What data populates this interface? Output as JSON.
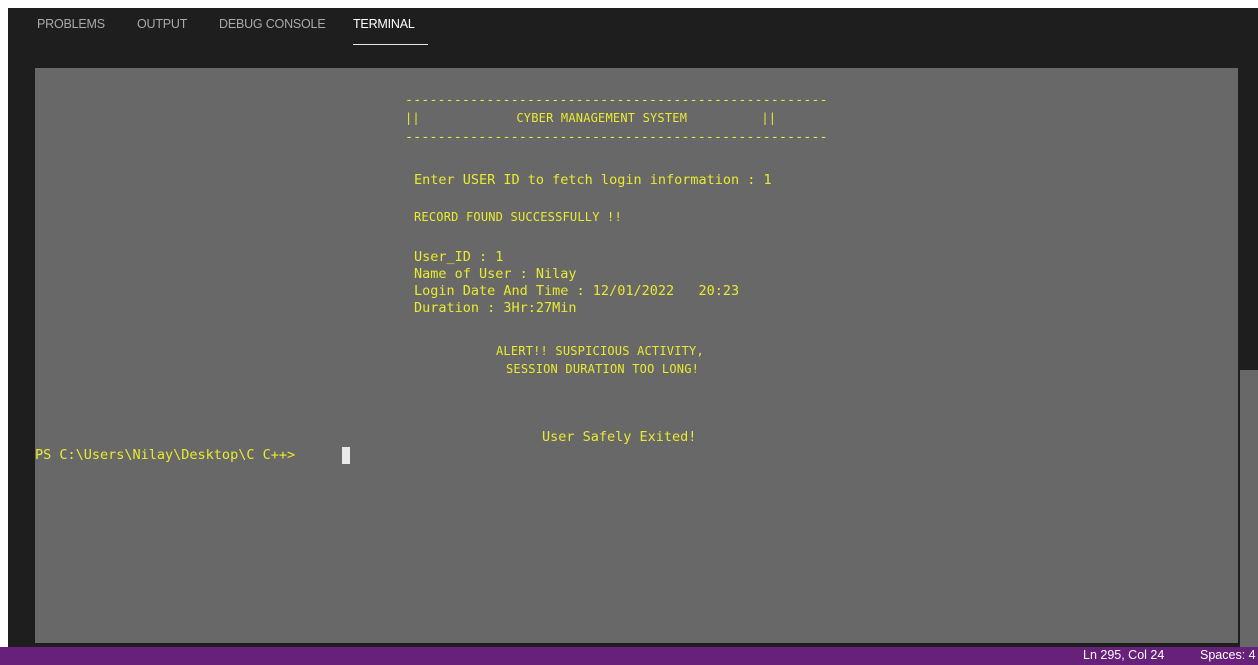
{
  "tabs": {
    "problems": "PROBLEMS",
    "output": "OUTPUT",
    "debug_console": "DEBUG CONSOLE",
    "terminal": "TERMINAL"
  },
  "terminal": {
    "border_top": "----------------------------------------------------",
    "title_line": "||             CYBER MANAGEMENT SYSTEM          ||",
    "border_bottom": "----------------------------------------------------",
    "prompt_line": "Enter USER ID to fetch login information : 1",
    "record_found": "RECORD FOUND SUCCESSFULLY !!",
    "user_id": "User_ID : 1",
    "user_name": "Name of User : Nilay",
    "login_datetime": "Login Date And Time : 12/01/2022   20:23",
    "duration": "Duration : 3Hr:27Min",
    "alert_line1": "ALERT!! SUSPICIOUS ACTIVITY,",
    "alert_line2": "SESSION DURATION TOO LONG!",
    "exit_message": "User Safely Exited!",
    "shell_prompt": "PS C:\\Users\\Nilay\\Desktop\\C C++> "
  },
  "statusbar": {
    "position": "Ln 295, Col 24",
    "spaces": "Spaces: 4"
  },
  "colors": {
    "terminal_bg": "#686868",
    "terminal_text": "#eaea30",
    "statusbar_bg": "#68217a",
    "panel_bg": "#1e1e1e"
  }
}
